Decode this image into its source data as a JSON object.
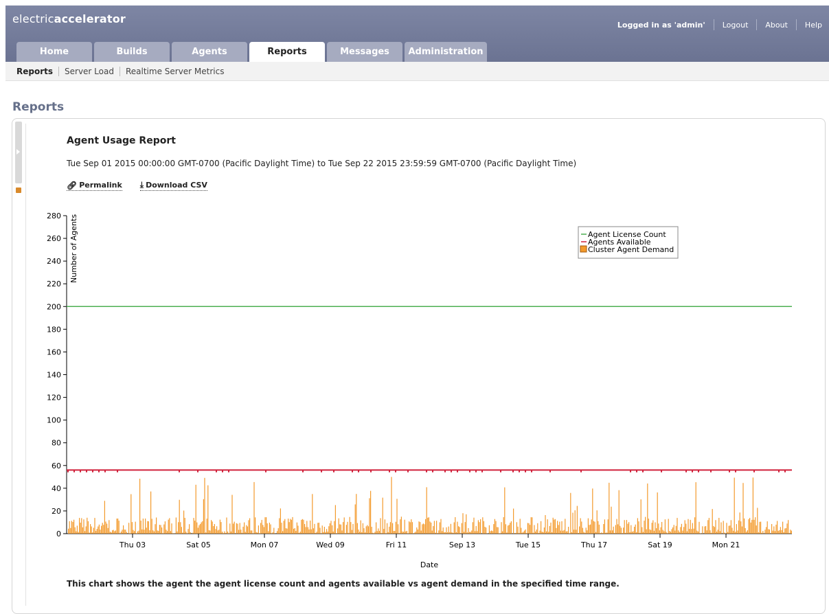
{
  "header": {
    "logo_light": "electric",
    "logo_bold": "accelerator",
    "logged_in": "Logged in as 'admin'",
    "links": [
      "Logout",
      "About",
      "Help"
    ]
  },
  "tabs": [
    "Home",
    "Builds",
    "Agents",
    "Reports",
    "Messages",
    "Administration"
  ],
  "active_tab": "Reports",
  "subnav": [
    "Reports",
    "Server Load",
    "Realtime Server Metrics"
  ],
  "page_title": "Reports",
  "report": {
    "title": "Agent Usage Report",
    "range": "Tue Sep 01 2015 00:00:00 GMT-0700 (Pacific Daylight Time) to Tue Sep 22 2015 23:59:59 GMT-0700 (Pacific Daylight Time)",
    "permalink": "Permalink",
    "download": "Download CSV",
    "caption": "This chart shows the agent the agent license count and agents available vs agent demand in the specified time range."
  },
  "icons": {
    "permalink": "link-icon",
    "download": "download-icon",
    "lock": "lock-icon",
    "expand": "chevron-right-icon"
  },
  "colors": {
    "license": "#4caf50",
    "available": "#d0213a",
    "demand": "#f39a2b",
    "header": "#747c9a"
  },
  "chart_data": {
    "type": "area",
    "xlabel": "Date",
    "ylabel": "Number of Agents",
    "ylim": [
      0,
      280
    ],
    "yticks": [
      0,
      20,
      40,
      60,
      80,
      100,
      120,
      140,
      160,
      180,
      200,
      220,
      240,
      260,
      280
    ],
    "xlim": [
      "2015-09-01",
      "2015-09-22 23:59"
    ],
    "xticks": [
      {
        "date": "2015-09-03",
        "label": "Thu 03"
      },
      {
        "date": "2015-09-05",
        "label": "Sat 05"
      },
      {
        "date": "2015-09-07",
        "label": "Mon 07"
      },
      {
        "date": "2015-09-09",
        "label": "Wed 09"
      },
      {
        "date": "2015-09-11",
        "label": "Fri 11"
      },
      {
        "date": "2015-09-13",
        "label": "Sep 13"
      },
      {
        "date": "2015-09-15",
        "label": "Tue 15"
      },
      {
        "date": "2015-09-17",
        "label": "Thu 17"
      },
      {
        "date": "2015-09-19",
        "label": "Sat 19"
      },
      {
        "date": "2015-09-21",
        "label": "Mon 21"
      }
    ],
    "legend": [
      "Agent License Count",
      "Agents Available",
      "Cluster Agent Demand"
    ],
    "legend_position": "top-right",
    "series": [
      {
        "name": "Agent License Count",
        "type": "line",
        "value": 200
      },
      {
        "name": "Agents Available",
        "type": "line",
        "value": 56,
        "dips_to": 54
      },
      {
        "name": "Cluster Agent Demand",
        "type": "area",
        "typical_range": [
          0,
          15
        ],
        "peak": 50
      }
    ]
  }
}
